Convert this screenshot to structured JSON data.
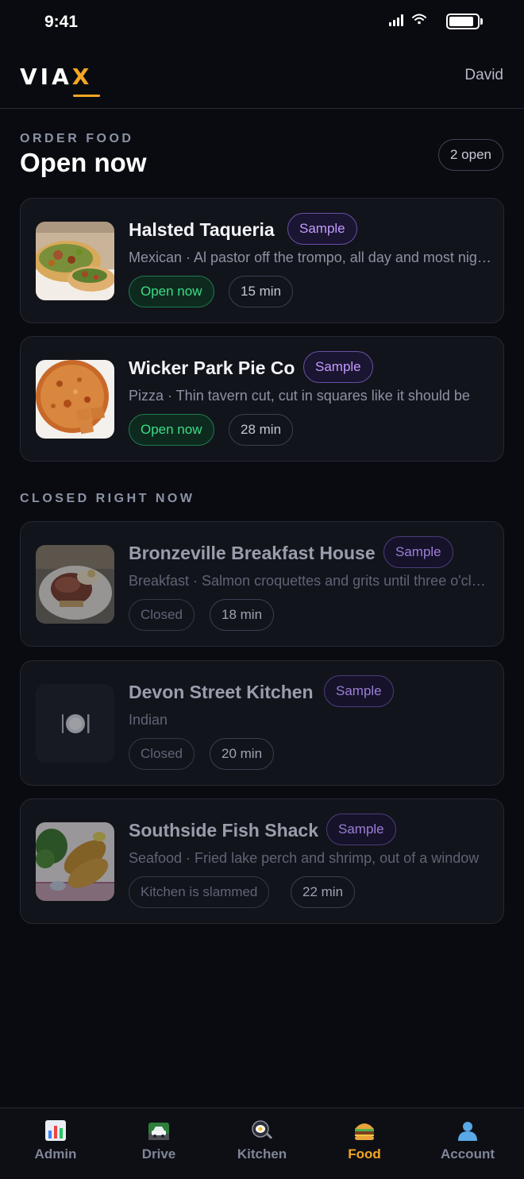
{
  "status_bar": {
    "time": "9:41"
  },
  "header": {
    "logo_main": "VIA",
    "logo_accent": "X",
    "user": "David"
  },
  "open_section": {
    "eyebrow": "ORDER FOOD",
    "title": "Open now",
    "count_badge": "2 open"
  },
  "closed_section": {
    "eyebrow": "CLOSED RIGHT NOW"
  },
  "restaurants_open": [
    {
      "name": "Halsted Taqueria",
      "badge": "Sample",
      "desc": "Mexican · Al pastor off the trompo, all day and most nights",
      "status": "Open now",
      "eta": "15 min",
      "image": "tacos"
    },
    {
      "name": "Wicker Park Pie Co",
      "badge": "Sample",
      "desc": "Pizza · Thin tavern cut, cut in squares like it should be",
      "status": "Open now",
      "eta": "28 min",
      "image": "pizza"
    }
  ],
  "restaurants_closed": [
    {
      "name": "Bronzeville Breakfast House",
      "badge": "Sample",
      "desc": "Breakfast · Salmon croquettes and grits until three o'clock",
      "status": "Closed",
      "eta": "18 min",
      "image": "breakfast"
    },
    {
      "name": "Devon Street Kitchen",
      "badge": "Sample",
      "desc": "Indian",
      "status": "Closed",
      "eta": "20 min",
      "image": "plate-icon"
    },
    {
      "name": "Southside Fish Shack",
      "badge": "Sample",
      "desc": "Seafood · Fried lake perch and shrimp, out of a window",
      "status": "Kitchen is slammed",
      "eta": "22 min",
      "image": "fish"
    }
  ],
  "nav": [
    {
      "label": "Admin",
      "icon": "bar-chart-icon"
    },
    {
      "label": "Drive",
      "icon": "car-icon"
    },
    {
      "label": "Kitchen",
      "icon": "frying-pan-icon"
    },
    {
      "label": "Food",
      "icon": "burger-icon",
      "active": true
    },
    {
      "label": "Account",
      "icon": "user-icon"
    }
  ],
  "colors": {
    "accent": "#f5a623",
    "open_green": "#3ddc84",
    "sample_purple": "#c39bff",
    "background": "#0a0b10"
  }
}
